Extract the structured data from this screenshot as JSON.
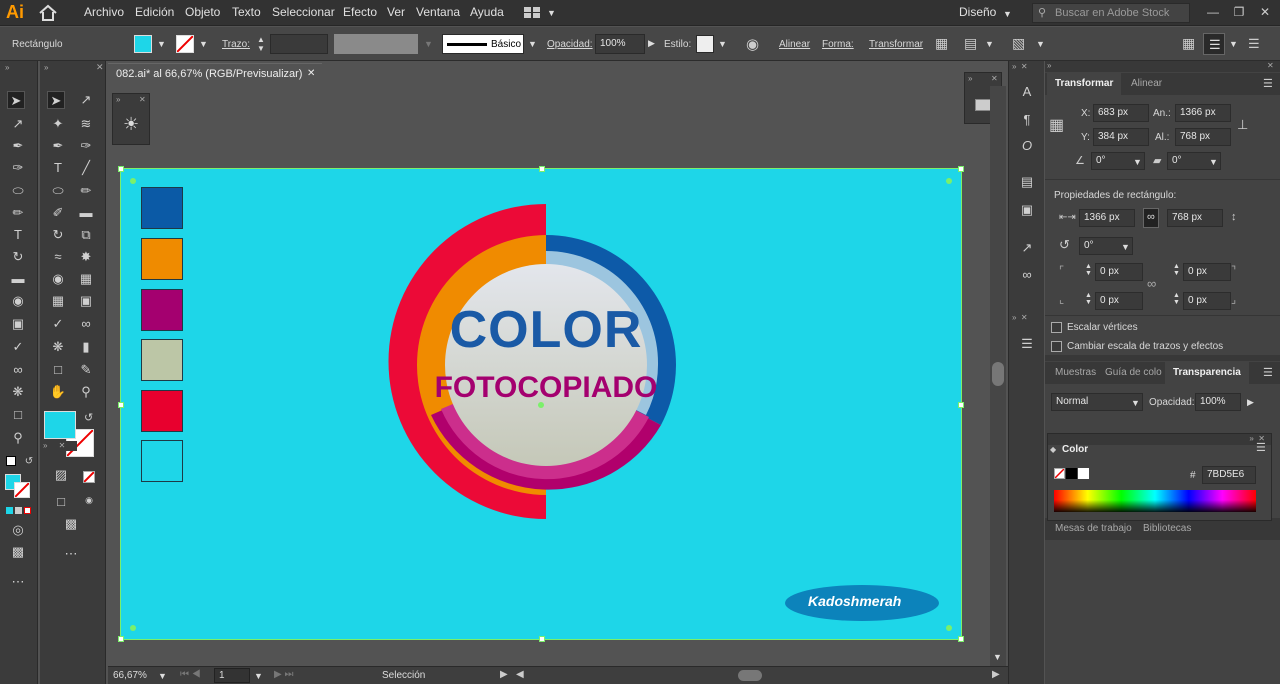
{
  "app": {
    "logo": "Ai",
    "workspace": "Diseño",
    "search_placeholder": "Buscar en Adobe Stock"
  },
  "menu": [
    "Archivo",
    "Edición",
    "Objeto",
    "Texto",
    "Seleccionar",
    "Efecto",
    "Ver",
    "Ventana",
    "Ayuda"
  ],
  "control": {
    "object_type": "Rectángulo",
    "fill_color": "#1ed6e8",
    "stroke_label": "Trazo:",
    "brush_label": "Básico",
    "opacity_label": "Opacidad:",
    "opacity_value": "100%",
    "style_label": "Estilo:",
    "align_label": "Alinear",
    "shape_label": "Forma:",
    "transform_label": "Transformar"
  },
  "document": {
    "tab_title": "082.ai* al 66,67% (RGB/Previsualizar)",
    "zoom": "66,67%",
    "page": "1",
    "status_tool": "Selección"
  },
  "artboard": {
    "background": "#1ed6e8",
    "swatches": [
      "#0b5aa6",
      "#ef8b00",
      "#a4006f",
      "#bcc6a6",
      "#e8002e",
      "#1ed6e8"
    ],
    "logo_title": "COLOR",
    "logo_subtitle": "FOTOCOPIADO",
    "signature": "Kadoshmerah"
  },
  "transform": {
    "tabs": [
      "Transformar",
      "Alinear"
    ],
    "x_label": "X:",
    "x": "683 px",
    "y_label": "Y:",
    "y": "384 px",
    "w_label": "An.:",
    "w": "1366 px",
    "h_label": "Al.:",
    "h": "768 px",
    "angle": "0°",
    "shear": "0°",
    "rect_props_title": "Propiedades de rectángulo:",
    "rect_w": "1366 px",
    "rect_h": "768 px",
    "rotation": "0°",
    "corner_tl": "0 px",
    "corner_tr": "0 px",
    "corner_bl": "0 px",
    "corner_br": "0 px",
    "scale_corners": "Escalar vértices",
    "scale_strokes": "Cambiar escala de trazos y efectos"
  },
  "transparency": {
    "tabs": [
      "Muestras",
      "Guía de colo",
      "Transparencia"
    ],
    "blend_mode": "Normal",
    "opacity_label": "Opacidad:",
    "opacity": "100%"
  },
  "color_panel": {
    "title": "Color",
    "hex_label": "#",
    "hex": "7BD5E6"
  },
  "bottom_tabs": [
    "Mesas de trabajo",
    "Bibliotecas"
  ]
}
